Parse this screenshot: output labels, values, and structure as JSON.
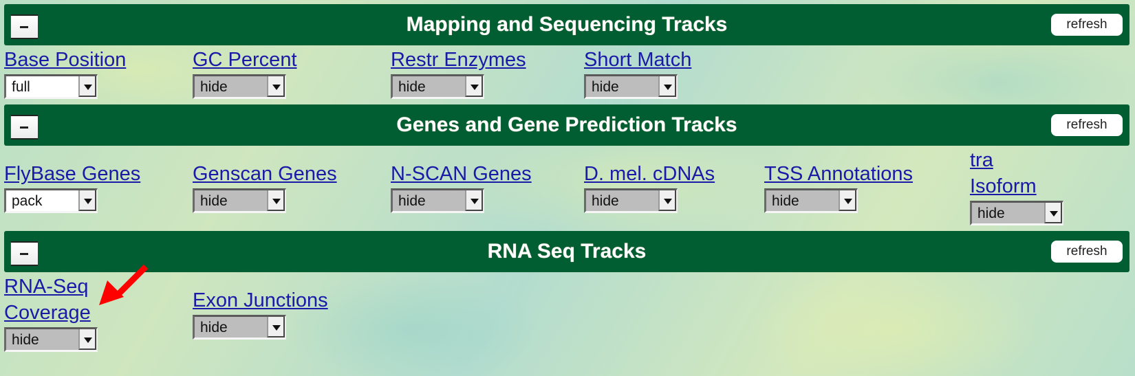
{
  "sections": [
    {
      "title": "Mapping and Sequencing Tracks",
      "collapse_label": "−",
      "refresh_label": "refresh",
      "tracks": [
        {
          "label": "Base Position",
          "value": "full"
        },
        {
          "label": "GC Percent",
          "value": "hide"
        },
        {
          "label": "Restr Enzymes",
          "value": "hide"
        },
        {
          "label": "Short Match",
          "value": "hide"
        }
      ]
    },
    {
      "title": "Genes and Gene Prediction Tracks",
      "collapse_label": "−",
      "refresh_label": "refresh",
      "tracks": [
        {
          "label": "FlyBase Genes",
          "value": "pack"
        },
        {
          "label": "Genscan Genes",
          "value": "hide"
        },
        {
          "label": "N-SCAN Genes",
          "value": "hide"
        },
        {
          "label": "D. mel. cDNAs",
          "value": "hide"
        },
        {
          "label": "TSS Annotations",
          "value": "hide"
        },
        {
          "label_line1": "tra",
          "label_line2": "Isoform",
          "value": "hide"
        }
      ]
    },
    {
      "title": "RNA Seq Tracks",
      "collapse_label": "−",
      "refresh_label": "refresh",
      "tracks": [
        {
          "label_line1": "RNA-Seq",
          "label_line2": "Coverage",
          "value": "hide"
        },
        {
          "label": "Exon Junctions",
          "value": "hide"
        }
      ]
    }
  ],
  "annotation": {
    "icon": "red-arrow-icon",
    "color": "#ff0000",
    "target": "RNA-Seq Coverage"
  }
}
